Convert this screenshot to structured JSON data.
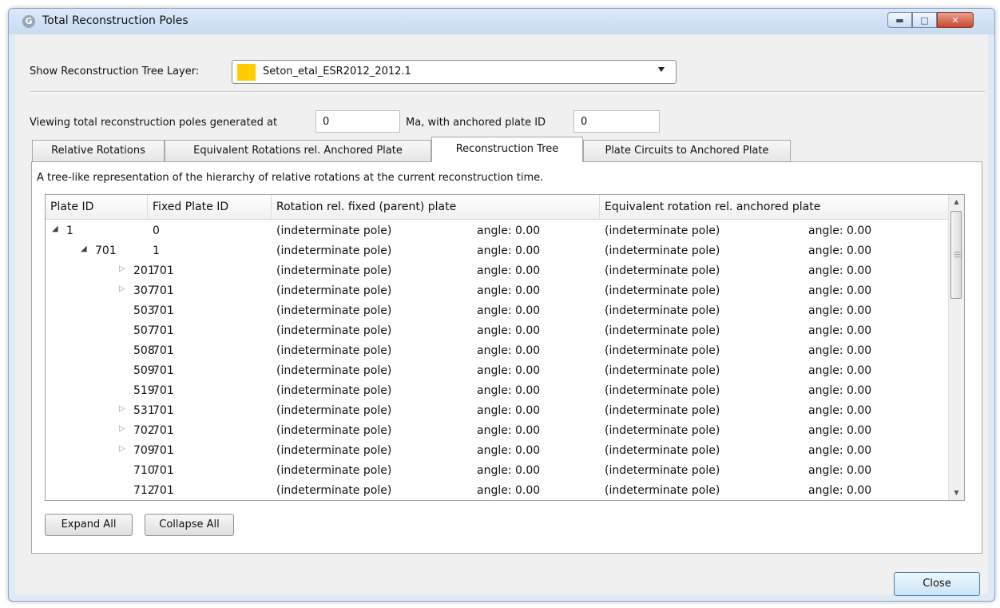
{
  "window": {
    "title": "Total Reconstruction Poles",
    "app_icon_glyph": "G"
  },
  "layer": {
    "label": "Show Reconstruction Tree Layer:",
    "selected": "Seton_etal_ESR2012_2012.1",
    "swatch_color": "#ffcc00"
  },
  "viewing": {
    "prefix": "Viewing total reconstruction poles generated at",
    "time_value": "0",
    "middle": "Ma, with anchored plate ID",
    "plate_value": "0"
  },
  "tabs": [
    {
      "label": "Relative Rotations"
    },
    {
      "label": "Equivalent Rotations rel. Anchored Plate"
    },
    {
      "label": "Reconstruction Tree"
    },
    {
      "label": "Plate Circuits to Anchored Plate"
    }
  ],
  "description": "A tree-like representation of the hierarchy of relative rotations at the current reconstruction time.",
  "tree": {
    "columns": [
      "Plate ID",
      "Fixed Plate ID",
      "Rotation rel. fixed (parent) plate",
      "Equivalent rotation rel. anchored plate"
    ],
    "rows": [
      {
        "plate": "1",
        "fixed": "0",
        "rot_pole": "(indeterminate pole)",
        "rot_angle": "angle: 0.00",
        "eq_pole": "(indeterminate pole)",
        "eq_angle": "angle: 0.00",
        "expander": "expanded",
        "depth": 0
      },
      {
        "plate": "701",
        "fixed": "1",
        "rot_pole": "(indeterminate pole)",
        "rot_angle": "angle: 0.00",
        "eq_pole": "(indeterminate pole)",
        "eq_angle": "angle: 0.00",
        "expander": "expanded",
        "depth": 1
      },
      {
        "plate": "201",
        "fixed": "701",
        "rot_pole": "(indeterminate pole)",
        "rot_angle": "angle: 0.00",
        "eq_pole": "(indeterminate pole)",
        "eq_angle": "angle: 0.00",
        "expander": "collapsed",
        "depth": 2
      },
      {
        "plate": "307",
        "fixed": "701",
        "rot_pole": "(indeterminate pole)",
        "rot_angle": "angle: 0.00",
        "eq_pole": "(indeterminate pole)",
        "eq_angle": "angle: 0.00",
        "expander": "collapsed",
        "depth": 2
      },
      {
        "plate": "503",
        "fixed": "701",
        "rot_pole": "(indeterminate pole)",
        "rot_angle": "angle: 0.00",
        "eq_pole": "(indeterminate pole)",
        "eq_angle": "angle: 0.00",
        "expander": "none",
        "depth": 2
      },
      {
        "plate": "507",
        "fixed": "701",
        "rot_pole": "(indeterminate pole)",
        "rot_angle": "angle: 0.00",
        "eq_pole": "(indeterminate pole)",
        "eq_angle": "angle: 0.00",
        "expander": "none",
        "depth": 2
      },
      {
        "plate": "508",
        "fixed": "701",
        "rot_pole": "(indeterminate pole)",
        "rot_angle": "angle: 0.00",
        "eq_pole": "(indeterminate pole)",
        "eq_angle": "angle: 0.00",
        "expander": "none",
        "depth": 2
      },
      {
        "plate": "509",
        "fixed": "701",
        "rot_pole": "(indeterminate pole)",
        "rot_angle": "angle: 0.00",
        "eq_pole": "(indeterminate pole)",
        "eq_angle": "angle: 0.00",
        "expander": "none",
        "depth": 2
      },
      {
        "plate": "519",
        "fixed": "701",
        "rot_pole": "(indeterminate pole)",
        "rot_angle": "angle: 0.00",
        "eq_pole": "(indeterminate pole)",
        "eq_angle": "angle: 0.00",
        "expander": "none",
        "depth": 2
      },
      {
        "plate": "531",
        "fixed": "701",
        "rot_pole": "(indeterminate pole)",
        "rot_angle": "angle: 0.00",
        "eq_pole": "(indeterminate pole)",
        "eq_angle": "angle: 0.00",
        "expander": "collapsed",
        "depth": 2
      },
      {
        "plate": "702",
        "fixed": "701",
        "rot_pole": "(indeterminate pole)",
        "rot_angle": "angle: 0.00",
        "eq_pole": "(indeterminate pole)",
        "eq_angle": "angle: 0.00",
        "expander": "collapsed",
        "depth": 2
      },
      {
        "plate": "709",
        "fixed": "701",
        "rot_pole": "(indeterminate pole)",
        "rot_angle": "angle: 0.00",
        "eq_pole": "(indeterminate pole)",
        "eq_angle": "angle: 0.00",
        "expander": "collapsed",
        "depth": 2
      },
      {
        "plate": "710",
        "fixed": "701",
        "rot_pole": "(indeterminate pole)",
        "rot_angle": "angle: 0.00",
        "eq_pole": "(indeterminate pole)",
        "eq_angle": "angle: 0.00",
        "expander": "none",
        "depth": 2
      },
      {
        "plate": "712",
        "fixed": "701",
        "rot_pole": "(indeterminate pole)",
        "rot_angle": "angle: 0.00",
        "eq_pole": "(indeterminate pole)",
        "eq_angle": "angle: 0.00",
        "expander": "none",
        "depth": 2
      }
    ]
  },
  "buttons": {
    "expand_all": "Expand All",
    "collapse_all": "Collapse All",
    "close": "Close"
  },
  "icons": {
    "expanded": "expanded-triangle-icon",
    "collapsed": "collapsed-triangle-icon",
    "minimize": "minimize-icon",
    "maximize": "maximize-icon",
    "close": "close-icon"
  }
}
